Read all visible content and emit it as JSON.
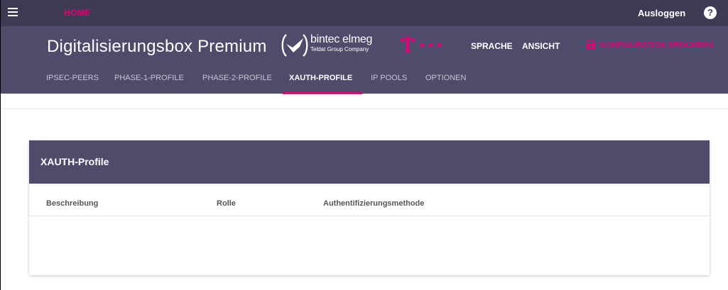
{
  "topbar": {
    "menu_icon": "hamburger-icon",
    "home_label": "HOME",
    "logout_label": "Ausloggen",
    "help_icon": "question-circle-icon",
    "help_glyph": "?"
  },
  "header": {
    "product_title": "Digitalisierungsbox Premium",
    "brand_name": "bintec elmeg",
    "brand_subtitle": "Teldat Group Company",
    "language_label": "SPRACHE",
    "view_label": "ANSICHT",
    "save_label": "KONFIGURATION SPEICHERN",
    "save_icon": "floppy-disk-icon"
  },
  "tabs": [
    {
      "label": "IPSEC-PEERS",
      "active": false
    },
    {
      "label": "PHASE-1-PROFILE",
      "active": false
    },
    {
      "label": "PHASE-2-PROFILE",
      "active": false
    },
    {
      "label": "XAUTH-PROFILE",
      "active": true
    },
    {
      "label": "IP POOLS",
      "active": false
    },
    {
      "label": "OPTIONEN",
      "active": false
    }
  ],
  "card": {
    "title": "XAUTH-Profile",
    "columns": [
      "Beschreibung",
      "Rolle",
      "Authentifizierungsmethode"
    ],
    "rows": []
  },
  "colors": {
    "topbar_bg": "#3d3b54",
    "header_bg": "#4e4c6a",
    "accent_magenta": "#e20074"
  }
}
